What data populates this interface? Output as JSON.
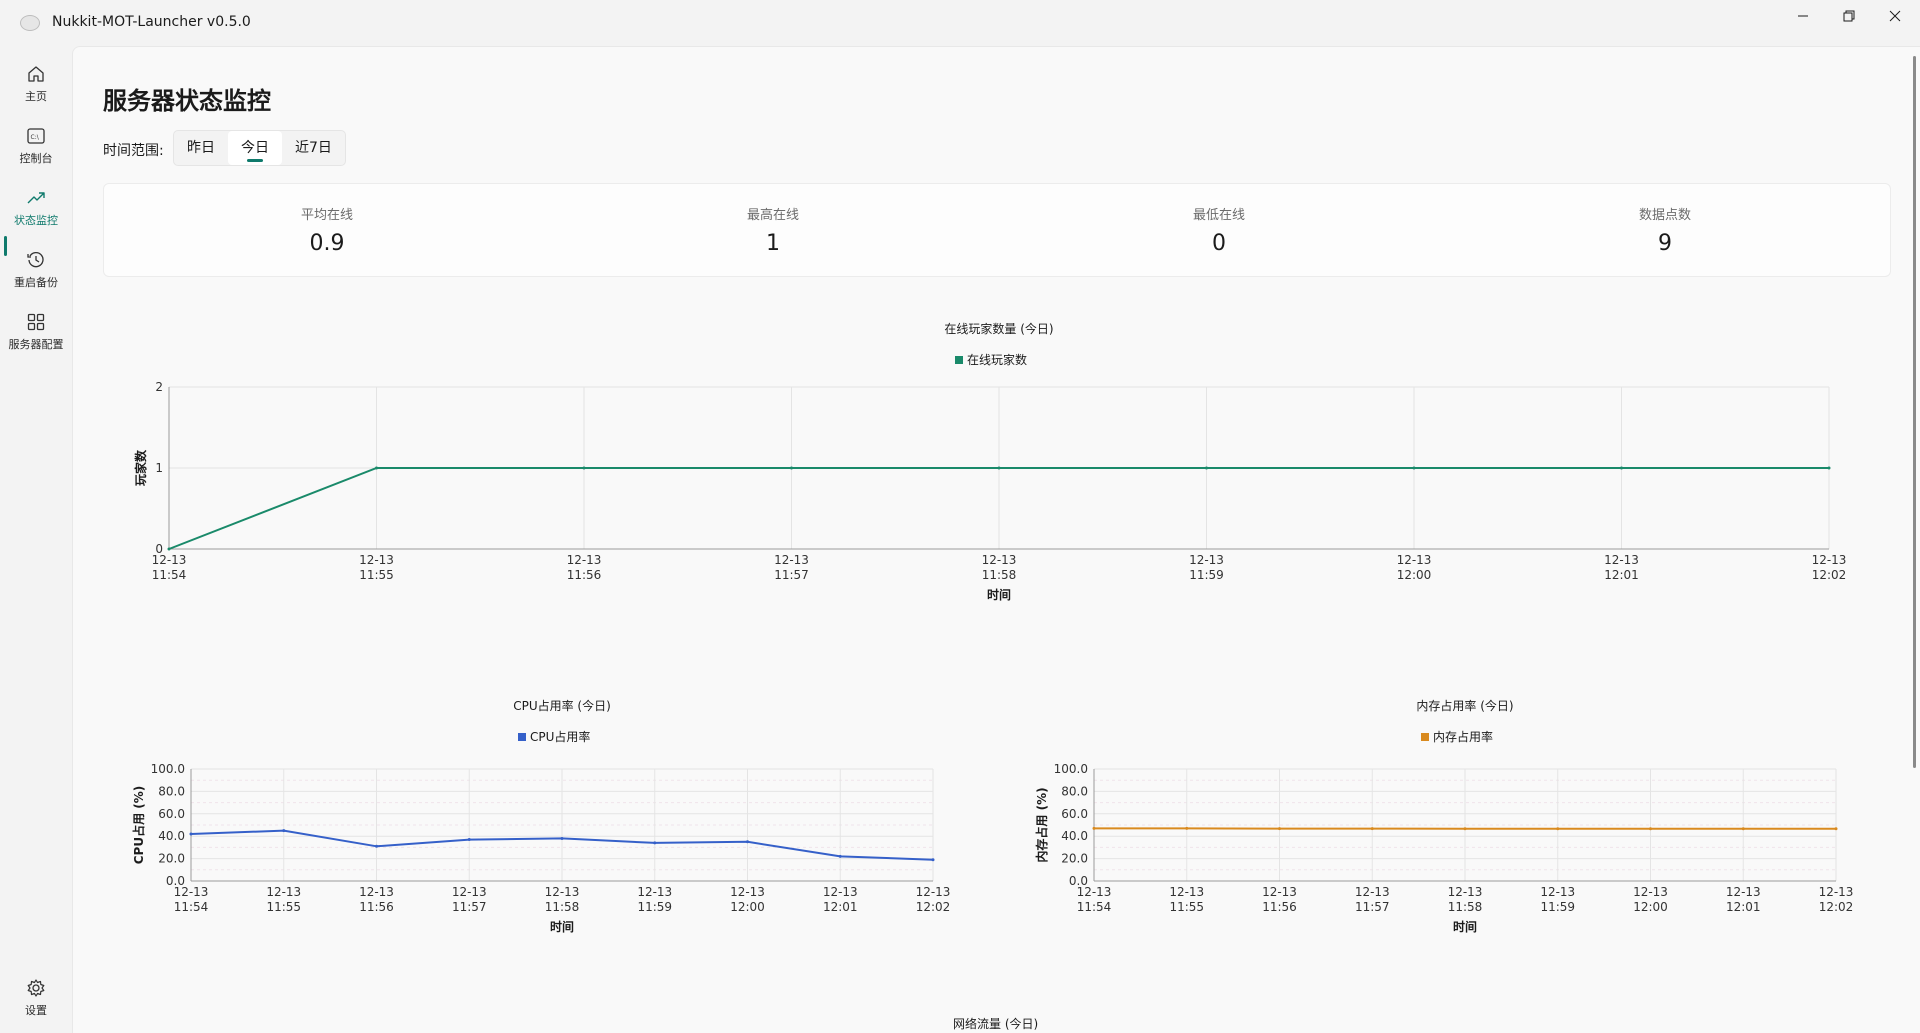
{
  "window": {
    "title": "Nukkit-MOT-Launcher v0.5.0"
  },
  "sidebar": {
    "items": [
      {
        "label": "主页",
        "icon": "home-icon"
      },
      {
        "label": "控制台",
        "icon": "console-icon"
      },
      {
        "label": "状态监控",
        "icon": "trending-up-icon"
      },
      {
        "label": "重启备份",
        "icon": "history-icon"
      },
      {
        "label": "服务器配置",
        "icon": "grid-icon"
      }
    ],
    "settings_label": "设置",
    "active_color": "#0f7a6c"
  },
  "page": {
    "title": "服务器状态监控",
    "range_label": "时间范围:",
    "range_options": [
      "昨日",
      "今日",
      "近7日"
    ],
    "range_selected": "今日"
  },
  "stats": [
    {
      "label": "平均在线",
      "value": "0.9"
    },
    {
      "label": "最高在线",
      "value": "1"
    },
    {
      "label": "最低在线",
      "value": "0"
    },
    {
      "label": "数据点数",
      "value": "9"
    }
  ],
  "chart_data": [
    {
      "type": "line",
      "title": "在线玩家数量 (今日)",
      "xlabel": "时间",
      "ylabel": "玩家数",
      "x": [
        "12-13 11:54",
        "12-13 11:55",
        "12-13 11:56",
        "12-13 11:57",
        "12-13 11:58",
        "12-13 11:59",
        "12-13 12:00",
        "12-13 12:01",
        "12-13 12:02"
      ],
      "series": [
        {
          "name": "在线玩家数",
          "color": "#1a8a6a",
          "values": [
            0,
            1,
            1,
            1,
            1,
            1,
            1,
            1,
            1
          ]
        }
      ],
      "ylim": [
        0,
        2
      ],
      "yticks": [
        "0",
        "1",
        "2"
      ],
      "legend": "top-center",
      "grid": true
    },
    {
      "type": "line",
      "title": "CPU占用率 (今日)",
      "xlabel": "时间",
      "ylabel": "CPU占用 (%)",
      "x": [
        "12-13 11:54",
        "12-13 11:55",
        "12-13 11:56",
        "12-13 11:57",
        "12-13 11:58",
        "12-13 11:59",
        "12-13 12:00",
        "12-13 12:01",
        "12-13 12:02"
      ],
      "series": [
        {
          "name": "CPU占用率",
          "color": "#3560c9",
          "values": [
            42,
            45,
            31,
            37,
            38,
            34,
            35,
            22,
            19
          ]
        }
      ],
      "ylim": [
        0,
        100
      ],
      "yticks": [
        "0.0",
        "20.0",
        "40.0",
        "60.0",
        "80.0",
        "100.0"
      ],
      "legend": "top-center",
      "grid": true
    },
    {
      "type": "line",
      "title": "内存占用率 (今日)",
      "xlabel": "时间",
      "ylabel": "内存占用 (%)",
      "x": [
        "12-13 11:54",
        "12-13 11:55",
        "12-13 11:56",
        "12-13 11:57",
        "12-13 11:58",
        "12-13 11:59",
        "12-13 12:00",
        "12-13 12:01",
        "12-13 12:02"
      ],
      "series": [
        {
          "name": "内存占用率",
          "color": "#d98a1f",
          "values": [
            47,
            47,
            46.8,
            46.8,
            46.7,
            46.6,
            46.6,
            46.6,
            46.6
          ]
        }
      ],
      "ylim": [
        0,
        100
      ],
      "yticks": [
        "0.0",
        "20.0",
        "40.0",
        "60.0",
        "80.0",
        "100.0"
      ],
      "legend": "top-center",
      "grid": true
    }
  ],
  "network_chart": {
    "title": "网络流量 (今日)"
  }
}
